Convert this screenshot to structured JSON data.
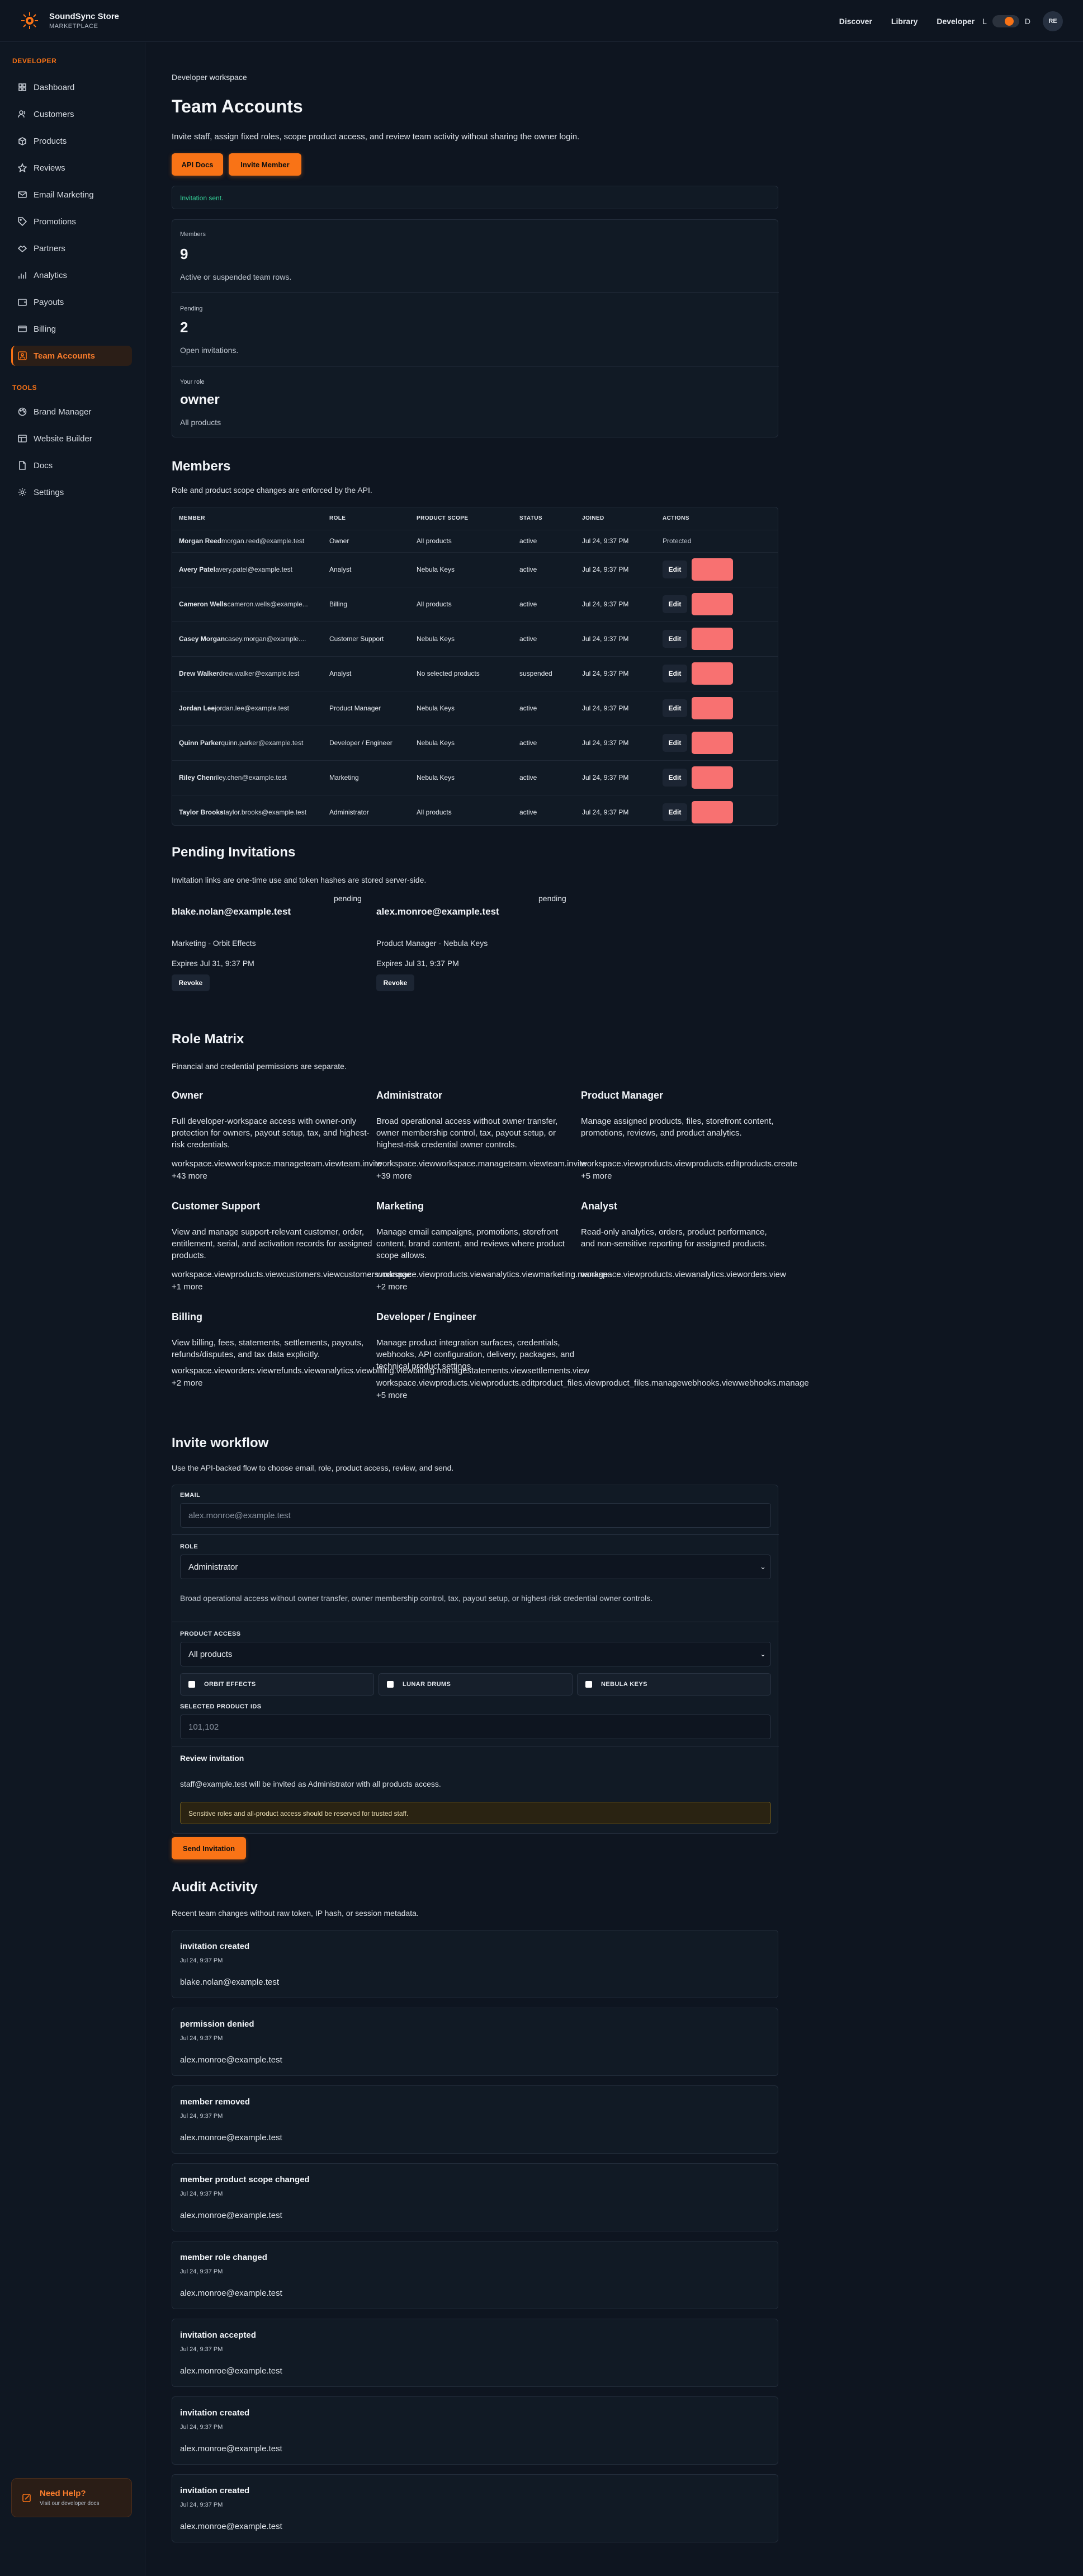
{
  "brand": {
    "name": "SoundSync Store",
    "sub": "MARKETPLACE"
  },
  "topnav": {
    "items": [
      "Discover",
      "Library",
      "Developer"
    ],
    "theme_light": "L",
    "theme_dark": "D",
    "avatar": "RE"
  },
  "sidebar": {
    "developer_label": "DEVELOPER",
    "developer_items": [
      {
        "label": "Dashboard",
        "icon": "grid-icon"
      },
      {
        "label": "Customers",
        "icon": "users-icon"
      },
      {
        "label": "Products",
        "icon": "box-icon"
      },
      {
        "label": "Reviews",
        "icon": "star-icon"
      },
      {
        "label": "Email Marketing",
        "icon": "mail-icon"
      },
      {
        "label": "Promotions",
        "icon": "tag-icon"
      },
      {
        "label": "Partners",
        "icon": "handshake-icon"
      },
      {
        "label": "Analytics",
        "icon": "chart-icon"
      },
      {
        "label": "Payouts",
        "icon": "wallet-icon"
      },
      {
        "label": "Billing",
        "icon": "card-icon"
      },
      {
        "label": "Team Accounts",
        "icon": "team-icon",
        "active": true
      }
    ],
    "tools_label": "TOOLS",
    "tools_items": [
      {
        "label": "Brand Manager",
        "icon": "palette-icon"
      },
      {
        "label": "Website Builder",
        "icon": "layout-icon"
      },
      {
        "label": "Docs",
        "icon": "doc-icon"
      },
      {
        "label": "Settings",
        "icon": "gear-icon"
      }
    ],
    "help": {
      "title": "Need Help?",
      "sub": "Visit our developer docs"
    }
  },
  "page": {
    "eyebrow": "Developer workspace",
    "title": "Team Accounts",
    "desc": "Invite staff, assign fixed roles, scope product access, and review team activity without sharing the owner login.",
    "api_docs": "API Docs",
    "invite_member": "Invite Member",
    "notice": "Invitation sent."
  },
  "stats": [
    {
      "label": "Members",
      "value": "9",
      "note": "Active or suspended team rows."
    },
    {
      "label": "Pending",
      "value": "2",
      "note": "Open invitations."
    },
    {
      "label": "Your role",
      "value": "owner",
      "note": "All products"
    }
  ],
  "members": {
    "title": "Members",
    "sub": "Role and product scope changes are enforced by the API.",
    "columns": [
      "MEMBER",
      "ROLE",
      "PRODUCT SCOPE",
      "STATUS",
      "JOINED",
      "ACTIONS"
    ],
    "edit_label": "Edit",
    "protected_label": "Protected",
    "rows": [
      {
        "name": "Morgan Reed",
        "email": "morgan.reed@example.test",
        "role": "Owner",
        "scope": "All products",
        "status": "active",
        "joined": "Jul 24, 9:37 PM",
        "protected": true
      },
      {
        "name": "Avery Patel",
        "email": "avery.patel@example.test",
        "role": "Analyst",
        "scope": "Nebula Keys",
        "status": "active",
        "joined": "Jul 24, 9:37 PM"
      },
      {
        "name": "Cameron Wells",
        "email": "cameron.wells@example...",
        "role": "Billing",
        "scope": "All products",
        "status": "active",
        "joined": "Jul 24, 9:37 PM"
      },
      {
        "name": "Casey Morgan",
        "email": "casey.morgan@example....",
        "role": "Customer Support",
        "scope": "Nebula Keys",
        "status": "active",
        "joined": "Jul 24, 9:37 PM"
      },
      {
        "name": "Drew Walker",
        "email": "drew.walker@example.test",
        "role": "Analyst",
        "scope": "No selected products",
        "status": "suspended",
        "joined": "Jul 24, 9:37 PM"
      },
      {
        "name": "Jordan Lee",
        "email": "jordan.lee@example.test",
        "role": "Product Manager",
        "scope": "Nebula Keys",
        "status": "active",
        "joined": "Jul 24, 9:37 PM"
      },
      {
        "name": "Quinn Parker",
        "email": "quinn.parker@example.test",
        "role": "Developer / Engineer",
        "scope": "Nebula Keys",
        "status": "active",
        "joined": "Jul 24, 9:37 PM"
      },
      {
        "name": "Riley Chen",
        "email": "riley.chen@example.test",
        "role": "Marketing",
        "scope": "Nebula Keys",
        "status": "active",
        "joined": "Jul 24, 9:37 PM"
      },
      {
        "name": "Taylor Brooks",
        "email": "taylor.brooks@example.test",
        "role": "Administrator",
        "scope": "All products",
        "status": "active",
        "joined": "Jul 24, 9:37 PM"
      }
    ]
  },
  "pending": {
    "title": "Pending Invitations",
    "sub": "Invitation links are one-time use and token hashes are stored server-side.",
    "revoke_label": "Revoke",
    "items": [
      {
        "email": "blake.nolan@example.test",
        "status": "pending",
        "role": "Marketing - Orbit Effects",
        "expires": "Expires Jul 31, 9:37 PM"
      },
      {
        "email": "alex.monroe@example.test",
        "status": "pending",
        "role": "Product Manager - Nebula Keys",
        "expires": "Expires Jul 31, 9:37 PM"
      }
    ]
  },
  "roles": {
    "title": "Role Matrix",
    "sub": "Financial and credential permissions are separate.",
    "items": [
      {
        "name": "Owner",
        "desc": "Full developer-workspace access with owner-only protection for owners, payout setup, tax, and highest-risk credentials.",
        "perms": "workspace.viewworkspace.manageteam.viewteam.invite",
        "more": "+43 more"
      },
      {
        "name": "Administrator",
        "desc": "Broad operational access without owner transfer, owner membership control, tax, payout setup, or highest-risk credential owner controls.",
        "perms": "workspace.viewworkspace.manageteam.viewteam.invite",
        "more": "+39 more"
      },
      {
        "name": "Product Manager",
        "desc": "Manage assigned products, files, storefront content, promotions, reviews, and product analytics.",
        "perms": "workspace.viewproducts.viewproducts.editproducts.create",
        "more": "+5 more"
      },
      {
        "name": "Customer Support",
        "desc": "View and manage support-relevant customer, order, entitlement, serial, and activation records for assigned products.",
        "perms": "workspace.viewproducts.viewcustomers.viewcustomers.manage",
        "more": "+1 more"
      },
      {
        "name": "Marketing",
        "desc": "Manage email campaigns, promotions, storefront content, brand content, and reviews where product scope allows.",
        "perms": "workspace.viewproducts.viewanalytics.viewmarketing.manage",
        "more": "+2 more"
      },
      {
        "name": "Analyst",
        "desc": "Read-only analytics, orders, product performance, and non-sensitive reporting for assigned products.",
        "perms": "workspace.viewproducts.viewanalytics.vieworders.view",
        "more": ""
      },
      {
        "name": "Billing",
        "desc": "View billing, fees, statements, settlements, payouts, refunds/disputes, and tax data explicitly.",
        "perms": "workspace.vieworders.viewrefunds.viewanalytics.viewbilling.viewbilling.managestatements.viewsettlements.view",
        "more": "+2 more"
      },
      {
        "name": "Developer / Engineer",
        "desc": "Manage product integration surfaces, credentials, webhooks, API configuration, delivery, packages, and technical product settings.",
        "perms": "workspace.viewproducts.viewproducts.editproduct_files.viewproduct_files.managewebhooks.viewwebhooks.manage",
        "more": "+5 more"
      }
    ]
  },
  "invite": {
    "title": "Invite workflow",
    "sub": "Use the API-backed flow to choose email, role, product access, review, and send.",
    "email_label": "EMAIL",
    "email_placeholder": "alex.monroe@example.test",
    "role_label": "ROLE",
    "role_value": "Administrator",
    "role_desc": "Broad operational access without owner transfer, owner membership control, tax, payout setup, or highest-risk credential owner controls.",
    "access_label": "PRODUCT ACCESS",
    "access_value": "All products",
    "products": [
      "ORBIT EFFECTS",
      "LUNAR DRUMS",
      "NEBULA KEYS"
    ],
    "ids_label": "SELECTED PRODUCT IDS",
    "ids_placeholder": "101,102",
    "review_title": "Review invitation",
    "review_text": "staff@example.test will be invited as Administrator with all products access.",
    "warning": "Sensitive roles and all-product access should be reserved for trusted staff.",
    "send": "Send Invitation"
  },
  "audit": {
    "title": "Audit Activity",
    "sub": "Recent team changes without raw token, IP hash, or session metadata.",
    "items": [
      {
        "event": "invitation created",
        "time": "Jul 24, 9:37 PM",
        "email": "blake.nolan@example.test"
      },
      {
        "event": "permission denied",
        "time": "Jul 24, 9:37 PM",
        "email": "alex.monroe@example.test"
      },
      {
        "event": "member removed",
        "time": "Jul 24, 9:37 PM",
        "email": "alex.monroe@example.test"
      },
      {
        "event": "member product scope changed",
        "time": "Jul 24, 9:37 PM",
        "email": "alex.monroe@example.test"
      },
      {
        "event": "member role changed",
        "time": "Jul 24, 9:37 PM",
        "email": "alex.monroe@example.test"
      },
      {
        "event": "invitation accepted",
        "time": "Jul 24, 9:37 PM",
        "email": "alex.monroe@example.test"
      },
      {
        "event": "invitation created",
        "time": "Jul 24, 9:37 PM",
        "email": "alex.monroe@example.test"
      },
      {
        "event": "invitation created",
        "time": "Jul 24, 9:37 PM",
        "email": "alex.monroe@example.test"
      }
    ]
  },
  "colors": {
    "accent": "#f97316",
    "danger": "#f87171",
    "success": "#34d399",
    "bg": "#0e1520"
  }
}
